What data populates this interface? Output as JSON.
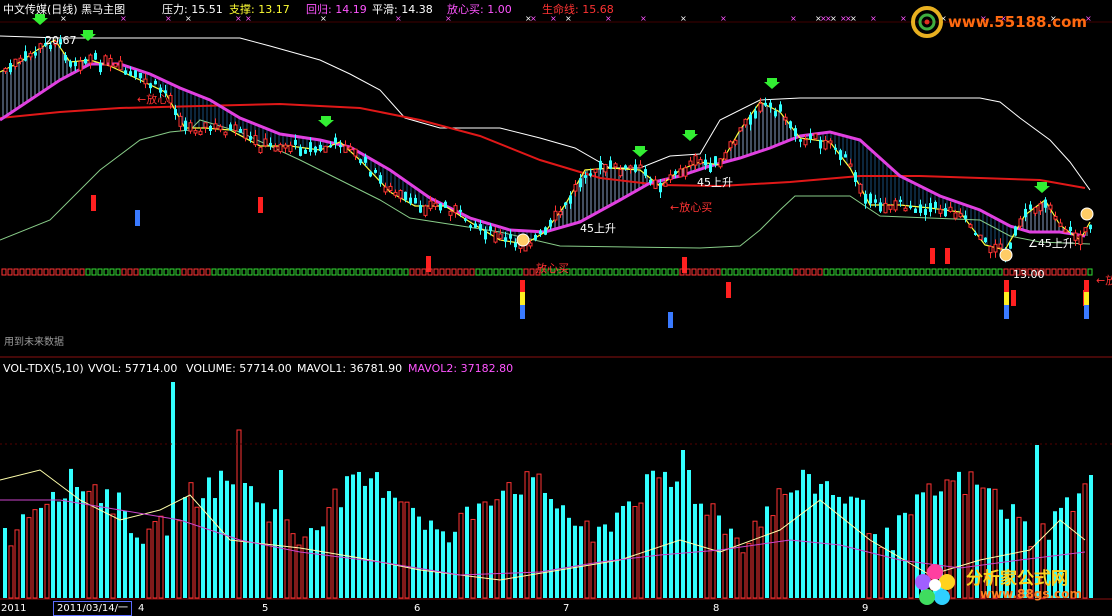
{
  "header": {
    "title": "中文传媒(日线) 黑马主图",
    "items": [
      {
        "label": "压力:",
        "value": "15.51",
        "color": "#ffffff"
      },
      {
        "label": "支撑:",
        "value": "13.17",
        "color": "#ffff33"
      },
      {
        "label": "回归:",
        "value": "14.19",
        "color": "#ff55ff"
      },
      {
        "label": "平滑:",
        "value": "14.38",
        "color": "#ffffff"
      },
      {
        "label": "放心买:",
        "value": "1.00",
        "color": "#ff55ff"
      },
      {
        "label": "生命线:",
        "value": "15.68",
        "color": "#ff3333"
      }
    ]
  },
  "annotations": {
    "high_label": "20.67",
    "low_label": "13.00",
    "future_data_note": "用到未来数据",
    "fangxin_left": "←放心",
    "fangxin_buy_mid": "←放心买",
    "fangxin_buy_low": "放心买",
    "fangxin_right": "←放",
    "rise45": "45上升",
    "rise45_b": "45上升",
    "rise45_c": "∠45上升"
  },
  "volume_header": {
    "name": "VOL-TDX(5,10)",
    "items": [
      {
        "label": "VVOL:",
        "value": "57714.00",
        "color": "#ffffff"
      },
      {
        "label": "VOLUME:",
        "value": "57714.00",
        "color": "#ffffff"
      },
      {
        "label": "MAVOL1:",
        "value": "36781.90",
        "color": "#ffffff"
      },
      {
        "label": "MAVOL2:",
        "value": "37182.80",
        "color": "#ff55ff"
      }
    ]
  },
  "x_axis": {
    "date_box": "2011/03/14/一",
    "left_clip": "2011",
    "months": [
      "4",
      "5",
      "6",
      "7",
      "8",
      "9"
    ]
  },
  "watermarks": {
    "top_site": "www.55188.com",
    "bottom_name": "分析家公式网",
    "bottom_site": "www.88gs.com"
  },
  "colors": {
    "up": "#ff3333",
    "down": "#33ffff",
    "magenta_line": "#e040e0",
    "red_line": "#e01818",
    "yellow_line": "#ffff40",
    "green_signal": "#33ee33"
  }
}
